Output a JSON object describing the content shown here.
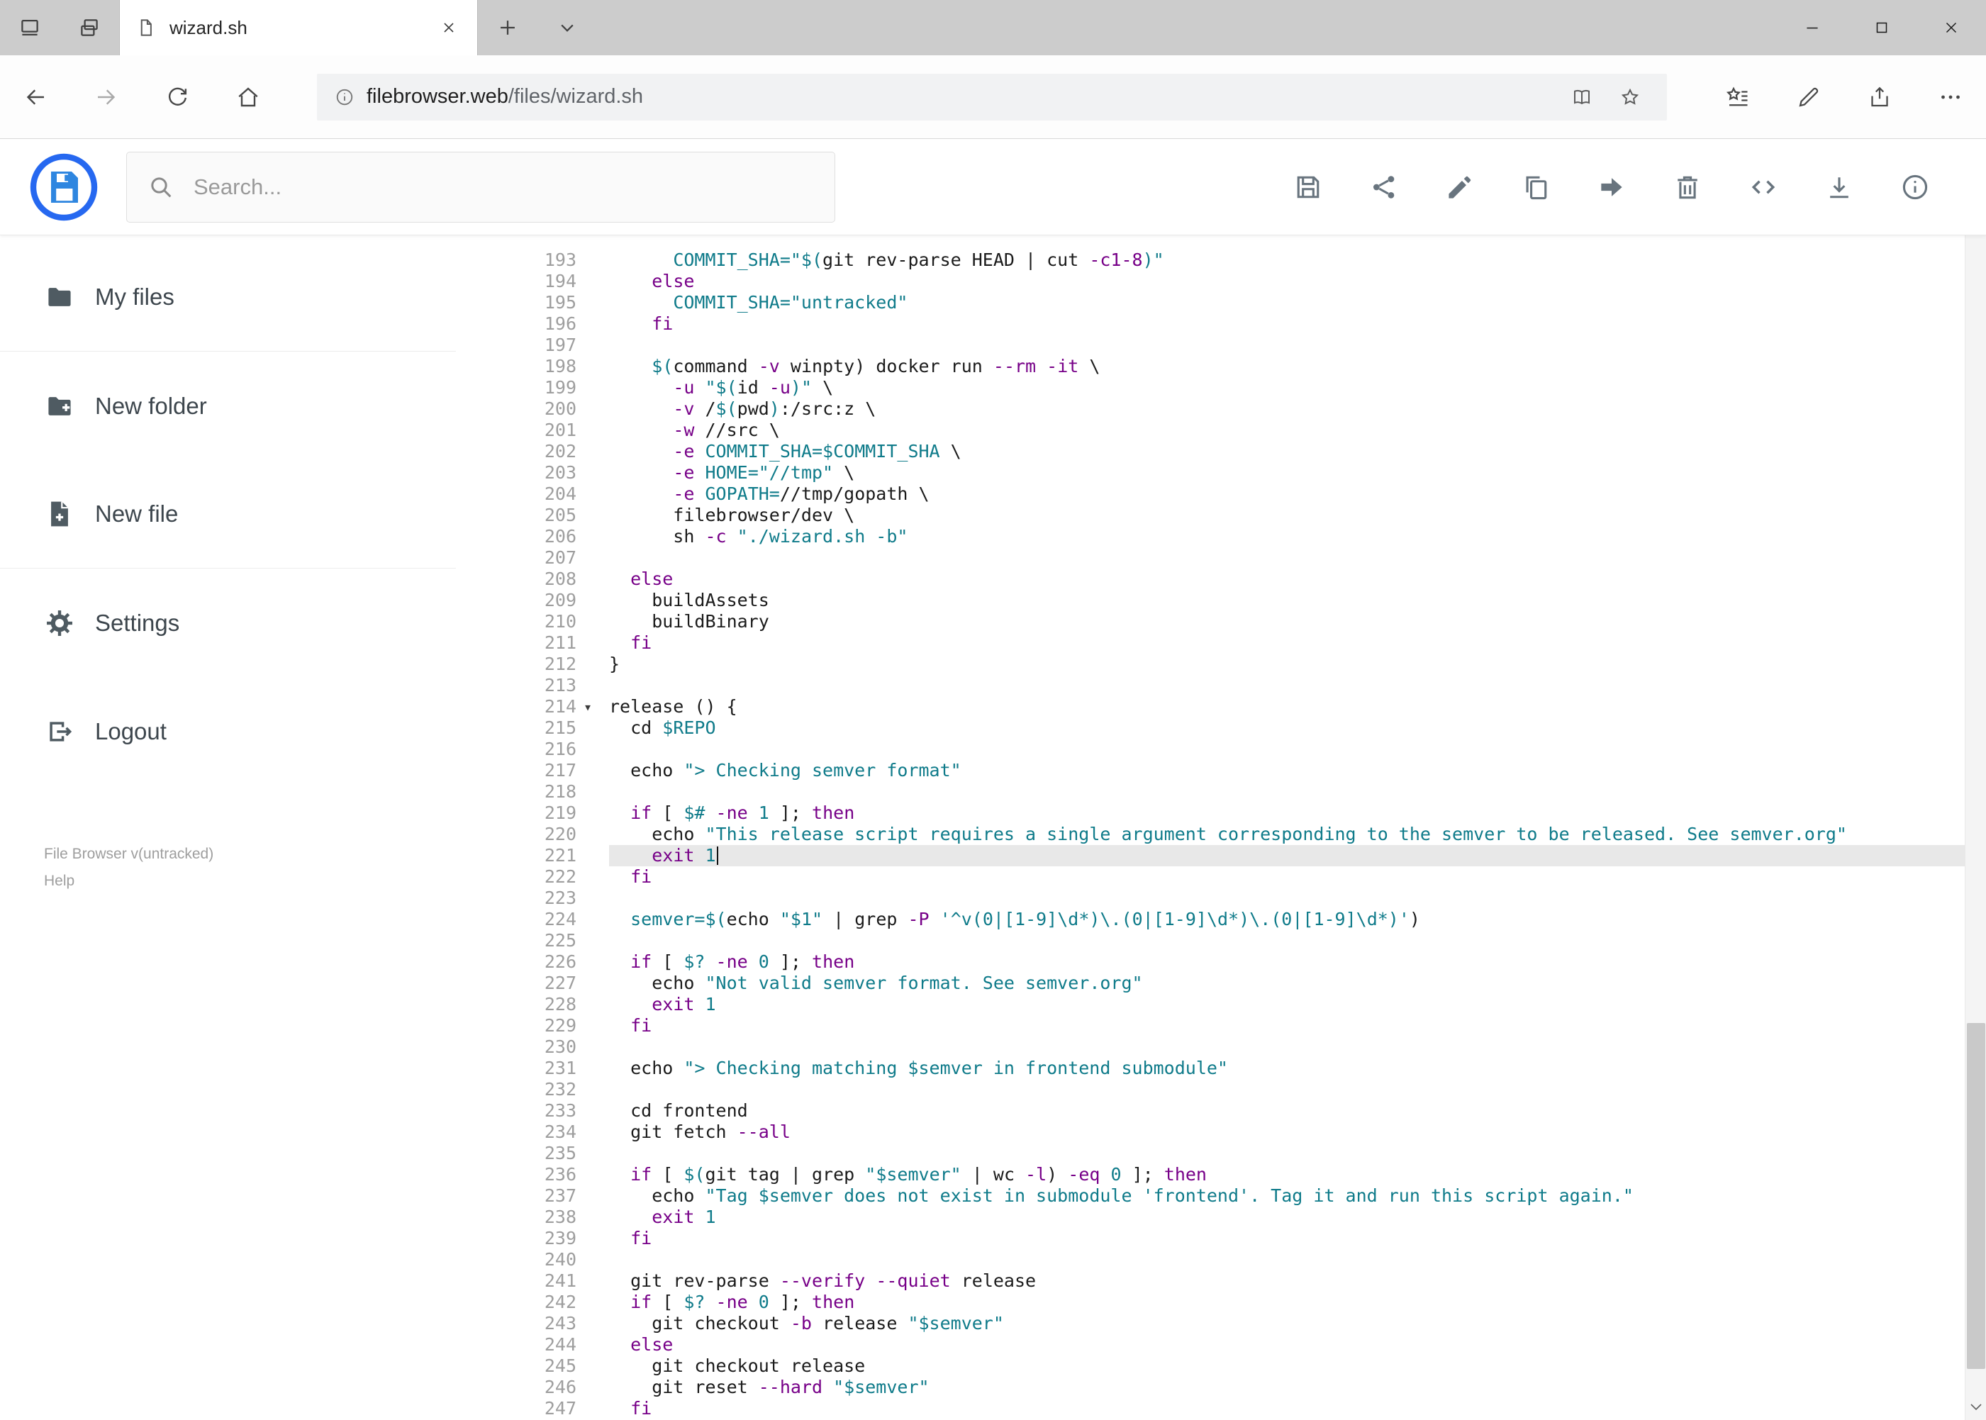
{
  "colors": {
    "accent": "#2979ff",
    "icon_gray": "#68747e",
    "sidebar_text": "#3d464d",
    "tok_plain": "#1b1b1b",
    "tok_keyword": "#770088",
    "tok_flag": "#770088",
    "tok_teal": "#0f7b8a",
    "gutter": "#9e9e9e",
    "active_line_bg": "#e8e8e8"
  },
  "browser": {
    "tab_title": "wizard.sh",
    "url_host": "filebrowser.web",
    "url_path": "/files/wizard.sh",
    "toolbar_icons": [
      "back",
      "forward",
      "refresh",
      "home"
    ],
    "urlbar_icons": [
      "page-info",
      "reading-view",
      "favorite-star"
    ],
    "right_icons": [
      "hub",
      "web-note",
      "share",
      "more"
    ],
    "window_controls": [
      "minimize",
      "maximize",
      "close"
    ]
  },
  "app": {
    "logo": "filebrowser-floppy-logo",
    "search_placeholder": "Search...",
    "toolbar_actions": [
      "save",
      "share",
      "rename",
      "copy",
      "move",
      "delete",
      "raw-code",
      "download",
      "info"
    ],
    "sidebar": {
      "items": [
        {
          "label": "My files",
          "icon": "folder"
        },
        {
          "label": "New folder",
          "icon": "new-folder"
        },
        {
          "label": "New file",
          "icon": "new-file"
        },
        {
          "label": "Settings",
          "icon": "settings-gear"
        },
        {
          "label": "Logout",
          "icon": "logout"
        }
      ],
      "version": "File Browser v(untracked)",
      "help": "Help"
    }
  },
  "editor": {
    "first_line": 193,
    "last_line": 247,
    "active_line": 221,
    "cursor_line": 221,
    "fold_marker_line": 214,
    "lines": [
      {
        "n": 193,
        "t": [
          [
            "p",
            "      "
          ],
          [
            "s",
            "COMMIT_SHA=\"$("
          ],
          [
            "p",
            "git rev-parse HEAD | cut "
          ],
          [
            "a",
            "-c1-8"
          ],
          [
            "s",
            ")\""
          ]
        ]
      },
      {
        "n": 194,
        "t": [
          [
            "p",
            "    "
          ],
          [
            "k",
            "else"
          ]
        ]
      },
      {
        "n": 195,
        "t": [
          [
            "p",
            "      "
          ],
          [
            "s",
            "COMMIT_SHA=\"untracked\""
          ]
        ]
      },
      {
        "n": 196,
        "t": [
          [
            "p",
            "    "
          ],
          [
            "k",
            "fi"
          ]
        ]
      },
      {
        "n": 197,
        "t": []
      },
      {
        "n": 198,
        "t": [
          [
            "p",
            "    "
          ],
          [
            "s",
            "$("
          ],
          [
            "p",
            "command "
          ],
          [
            "a",
            "-v"
          ],
          [
            "p",
            " winpty) docker run "
          ],
          [
            "a",
            "--rm"
          ],
          [
            "p",
            " "
          ],
          [
            "a",
            "-it"
          ],
          [
            "p",
            " \\"
          ]
        ]
      },
      {
        "n": 199,
        "t": [
          [
            "p",
            "      "
          ],
          [
            "a",
            "-u"
          ],
          [
            "p",
            " "
          ],
          [
            "s",
            "\"$("
          ],
          [
            "p",
            "id "
          ],
          [
            "a",
            "-u"
          ],
          [
            "s",
            ")\""
          ],
          [
            "p",
            " \\"
          ]
        ]
      },
      {
        "n": 200,
        "t": [
          [
            "p",
            "      "
          ],
          [
            "a",
            "-v"
          ],
          [
            "p",
            " /"
          ],
          [
            "s",
            "$("
          ],
          [
            "p",
            "pwd"
          ],
          [
            "s",
            ")"
          ],
          [
            "p",
            ":/src:z \\"
          ]
        ]
      },
      {
        "n": 201,
        "t": [
          [
            "p",
            "      "
          ],
          [
            "a",
            "-w"
          ],
          [
            "p",
            " //src \\"
          ]
        ]
      },
      {
        "n": 202,
        "t": [
          [
            "p",
            "      "
          ],
          [
            "a",
            "-e"
          ],
          [
            "p",
            " "
          ],
          [
            "s",
            "COMMIT_SHA=$COMMIT_SHA"
          ],
          [
            "p",
            " \\"
          ]
        ]
      },
      {
        "n": 203,
        "t": [
          [
            "p",
            "      "
          ],
          [
            "a",
            "-e"
          ],
          [
            "p",
            " "
          ],
          [
            "s",
            "HOME=\"//tmp\""
          ],
          [
            "p",
            " \\"
          ]
        ]
      },
      {
        "n": 204,
        "t": [
          [
            "p",
            "      "
          ],
          [
            "a",
            "-e"
          ],
          [
            "p",
            " "
          ],
          [
            "s",
            "GOPATH="
          ],
          [
            "p",
            "//tmp/gopath \\"
          ]
        ]
      },
      {
        "n": 205,
        "t": [
          [
            "p",
            "      filebrowser/dev \\"
          ]
        ]
      },
      {
        "n": 206,
        "t": [
          [
            "p",
            "      sh "
          ],
          [
            "a",
            "-c"
          ],
          [
            "p",
            " "
          ],
          [
            "s",
            "\"./wizard.sh -b\""
          ]
        ]
      },
      {
        "n": 207,
        "t": []
      },
      {
        "n": 208,
        "t": [
          [
            "p",
            "  "
          ],
          [
            "k",
            "else"
          ]
        ]
      },
      {
        "n": 209,
        "t": [
          [
            "p",
            "    buildAssets"
          ]
        ]
      },
      {
        "n": 210,
        "t": [
          [
            "p",
            "    buildBinary"
          ]
        ]
      },
      {
        "n": 211,
        "t": [
          [
            "p",
            "  "
          ],
          [
            "k",
            "fi"
          ]
        ]
      },
      {
        "n": 212,
        "t": [
          [
            "p",
            "}"
          ]
        ]
      },
      {
        "n": 213,
        "t": []
      },
      {
        "n": 214,
        "t": [
          [
            "p",
            "release () {"
          ]
        ]
      },
      {
        "n": 215,
        "t": [
          [
            "p",
            "  cd "
          ],
          [
            "s",
            "$REPO"
          ]
        ]
      },
      {
        "n": 216,
        "t": []
      },
      {
        "n": 217,
        "t": [
          [
            "p",
            "  echo "
          ],
          [
            "s",
            "\"> Checking semver format\""
          ]
        ]
      },
      {
        "n": 218,
        "t": []
      },
      {
        "n": 219,
        "t": [
          [
            "p",
            "  "
          ],
          [
            "k",
            "if"
          ],
          [
            "p",
            " [ "
          ],
          [
            "s",
            "$#"
          ],
          [
            "p",
            " "
          ],
          [
            "a",
            "-ne"
          ],
          [
            "p",
            " "
          ],
          [
            "s",
            "1"
          ],
          [
            "p",
            " ]; "
          ],
          [
            "k",
            "then"
          ]
        ]
      },
      {
        "n": 220,
        "t": [
          [
            "p",
            "    echo "
          ],
          [
            "s",
            "\"This release script requires a single argument corresponding to the semver to be released. See semver.org\""
          ]
        ]
      },
      {
        "n": 221,
        "t": [
          [
            "p",
            "    "
          ],
          [
            "k",
            "exit"
          ],
          [
            "p",
            " "
          ],
          [
            "s",
            "1"
          ]
        ]
      },
      {
        "n": 222,
        "t": [
          [
            "p",
            "  "
          ],
          [
            "k",
            "fi"
          ]
        ]
      },
      {
        "n": 223,
        "t": []
      },
      {
        "n": 224,
        "t": [
          [
            "p",
            "  "
          ],
          [
            "s",
            "semver=$("
          ],
          [
            "p",
            "echo "
          ],
          [
            "s",
            "\"$1\""
          ],
          [
            "p",
            " | grep "
          ],
          [
            "a",
            "-P"
          ],
          [
            "p",
            " "
          ],
          [
            "s",
            "'^v(0|[1-9]\\d*)\\.(0|[1-9]\\d*)\\.(0|[1-9]\\d*)'"
          ],
          [
            "p",
            ")"
          ]
        ]
      },
      {
        "n": 225,
        "t": []
      },
      {
        "n": 226,
        "t": [
          [
            "p",
            "  "
          ],
          [
            "k",
            "if"
          ],
          [
            "p",
            " [ "
          ],
          [
            "s",
            "$?"
          ],
          [
            "p",
            " "
          ],
          [
            "a",
            "-ne"
          ],
          [
            "p",
            " "
          ],
          [
            "s",
            "0"
          ],
          [
            "p",
            " ]; "
          ],
          [
            "k",
            "then"
          ]
        ]
      },
      {
        "n": 227,
        "t": [
          [
            "p",
            "    echo "
          ],
          [
            "s",
            "\"Not valid semver format. See semver.org\""
          ]
        ]
      },
      {
        "n": 228,
        "t": [
          [
            "p",
            "    "
          ],
          [
            "k",
            "exit"
          ],
          [
            "p",
            " "
          ],
          [
            "s",
            "1"
          ]
        ]
      },
      {
        "n": 229,
        "t": [
          [
            "p",
            "  "
          ],
          [
            "k",
            "fi"
          ]
        ]
      },
      {
        "n": 230,
        "t": []
      },
      {
        "n": 231,
        "t": [
          [
            "p",
            "  echo "
          ],
          [
            "s",
            "\"> Checking matching $semver in frontend submodule\""
          ]
        ]
      },
      {
        "n": 232,
        "t": []
      },
      {
        "n": 233,
        "t": [
          [
            "p",
            "  cd frontend"
          ]
        ]
      },
      {
        "n": 234,
        "t": [
          [
            "p",
            "  git fetch "
          ],
          [
            "a",
            "--all"
          ]
        ]
      },
      {
        "n": 235,
        "t": []
      },
      {
        "n": 236,
        "t": [
          [
            "p",
            "  "
          ],
          [
            "k",
            "if"
          ],
          [
            "p",
            " [ "
          ],
          [
            "s",
            "$("
          ],
          [
            "p",
            "git tag | grep "
          ],
          [
            "s",
            "\"$semver\""
          ],
          [
            "p",
            " | wc "
          ],
          [
            "a",
            "-l"
          ],
          [
            "p",
            ") "
          ],
          [
            "a",
            "-eq"
          ],
          [
            "p",
            " "
          ],
          [
            "s",
            "0"
          ],
          [
            "p",
            " ]; "
          ],
          [
            "k",
            "then"
          ]
        ]
      },
      {
        "n": 237,
        "t": [
          [
            "p",
            "    echo "
          ],
          [
            "s",
            "\"Tag $semver does not exist in submodule 'frontend'. Tag it and run this script again.\""
          ]
        ]
      },
      {
        "n": 238,
        "t": [
          [
            "p",
            "    "
          ],
          [
            "k",
            "exit"
          ],
          [
            "p",
            " "
          ],
          [
            "s",
            "1"
          ]
        ]
      },
      {
        "n": 239,
        "t": [
          [
            "p",
            "  "
          ],
          [
            "k",
            "fi"
          ]
        ]
      },
      {
        "n": 240,
        "t": []
      },
      {
        "n": 241,
        "t": [
          [
            "p",
            "  git rev-parse "
          ],
          [
            "a",
            "--verify"
          ],
          [
            "p",
            " "
          ],
          [
            "a",
            "--quiet"
          ],
          [
            "p",
            " release"
          ]
        ]
      },
      {
        "n": 242,
        "t": [
          [
            "p",
            "  "
          ],
          [
            "k",
            "if"
          ],
          [
            "p",
            " [ "
          ],
          [
            "s",
            "$?"
          ],
          [
            "p",
            " "
          ],
          [
            "a",
            "-ne"
          ],
          [
            "p",
            " "
          ],
          [
            "s",
            "0"
          ],
          [
            "p",
            " ]; "
          ],
          [
            "k",
            "then"
          ]
        ]
      },
      {
        "n": 243,
        "t": [
          [
            "p",
            "    git checkout "
          ],
          [
            "a",
            "-b"
          ],
          [
            "p",
            " release "
          ],
          [
            "s",
            "\"$semver\""
          ]
        ]
      },
      {
        "n": 244,
        "t": [
          [
            "p",
            "  "
          ],
          [
            "k",
            "else"
          ]
        ]
      },
      {
        "n": 245,
        "t": [
          [
            "p",
            "    git checkout release"
          ]
        ]
      },
      {
        "n": 246,
        "t": [
          [
            "p",
            "    git reset "
          ],
          [
            "a",
            "--hard"
          ],
          [
            "p",
            " "
          ],
          [
            "s",
            "\"$semver\""
          ]
        ]
      },
      {
        "n": 247,
        "t": [
          [
            "p",
            "  "
          ],
          [
            "k",
            "fi"
          ]
        ]
      }
    ]
  }
}
